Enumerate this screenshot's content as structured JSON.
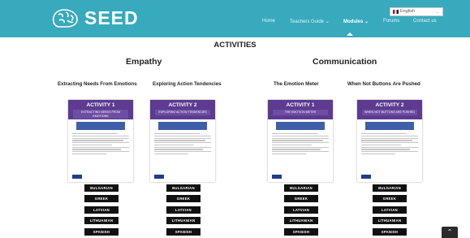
{
  "header": {
    "logo_text": "SEED",
    "nav": [
      "Home",
      "Teachers Guide ⌄",
      "Modules ⌄",
      "Forums",
      "Contact us"
    ],
    "language": "English"
  },
  "page_title": "ACTIVITIES",
  "sections": [
    {
      "title": "Empathy",
      "activities": [
        {
          "title": "Extracting Needs From Emotions",
          "card_label": "ACTIVITY 1",
          "card_subtitle": "EXTRACTING NEEDS FROM EMOTIONS"
        },
        {
          "title": "Exploring Action Tendencies",
          "card_label": "ACTIVITY 2",
          "card_subtitle": "EXPLORING ACTION TENDENCIES"
        }
      ]
    },
    {
      "title": "Communication",
      "activities": [
        {
          "title": "The Emotion Meter",
          "card_label": "ACTIVITY 1",
          "card_subtitle": "THE EMOTION METER"
        },
        {
          "title": "When Not Buttons Are Pushed",
          "card_label": "ACTIVITY 2",
          "card_subtitle": "WHEN NOT BUTTONS ARE PUSHED"
        }
      ]
    }
  ],
  "language_buttons": [
    "BULGARIAN",
    "GREEK",
    "LATVIAN",
    "LITHUANIAN",
    "SPANISH"
  ],
  "scroll_top": "⌃",
  "colors": {
    "header": "#37aabd",
    "card_band": "#5c3b90",
    "button": "#111111"
  }
}
